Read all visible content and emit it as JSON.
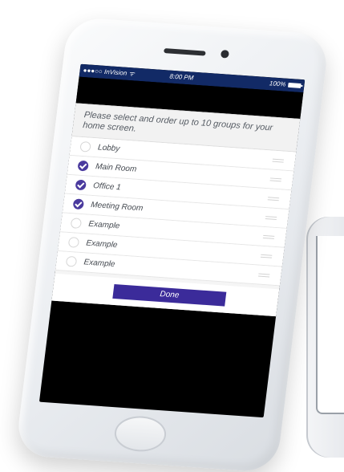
{
  "status_bar": {
    "carrier": "●●●○○ InVision ᯤ",
    "time": "8:00 PM",
    "battery_percent": "100%"
  },
  "screen": {
    "instruction": "Please select and order up to 10 groups for your home screen.",
    "groups": [
      {
        "label": "Lobby",
        "selected": false
      },
      {
        "label": "Main Room",
        "selected": true
      },
      {
        "label": "Office 1",
        "selected": true
      },
      {
        "label": "Meeting Room",
        "selected": true
      },
      {
        "label": "Example",
        "selected": false
      },
      {
        "label": "Example",
        "selected": false
      },
      {
        "label": "Example",
        "selected": false
      }
    ],
    "done_label": "Done"
  },
  "colors": {
    "status_bar": "#122a66",
    "accent": "#3b2b9a"
  },
  "icons": {
    "check": "checkmark-icon",
    "drag": "drag-handle-icon",
    "battery": "battery-icon",
    "wifi": "wifi-icon"
  }
}
